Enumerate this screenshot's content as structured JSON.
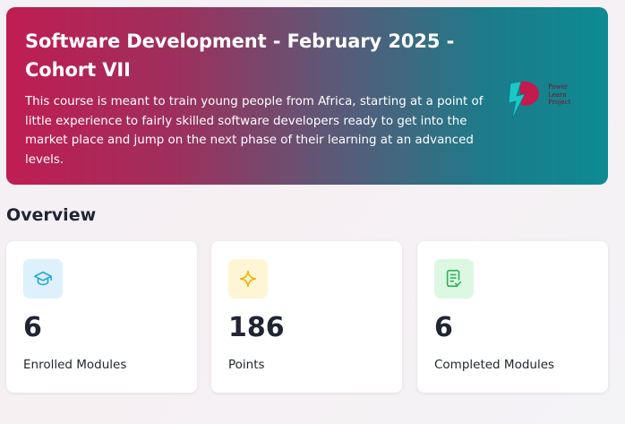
{
  "hero": {
    "title": "Software Development - February 2025 - Cohort VII",
    "description": "This course is meant to train young people from Africa, starting at a point of little experience to fairly skilled software developers ready to get into the market place and jump on the next phase of their learning at an advanced levels.",
    "logo_lines": [
      "Power",
      "Learn",
      "Project"
    ]
  },
  "overview": {
    "heading": "Overview",
    "cards": [
      {
        "value": "6",
        "label": "Enrolled Modules",
        "icon": "graduation-cap-icon",
        "color": "#2aa7d8"
      },
      {
        "value": "186",
        "label": "Points",
        "icon": "sparkle-icon",
        "color": "#e9b50c"
      },
      {
        "value": "6",
        "label": "Completed Modules",
        "icon": "document-check-icon",
        "color": "#2fb25a"
      }
    ]
  }
}
